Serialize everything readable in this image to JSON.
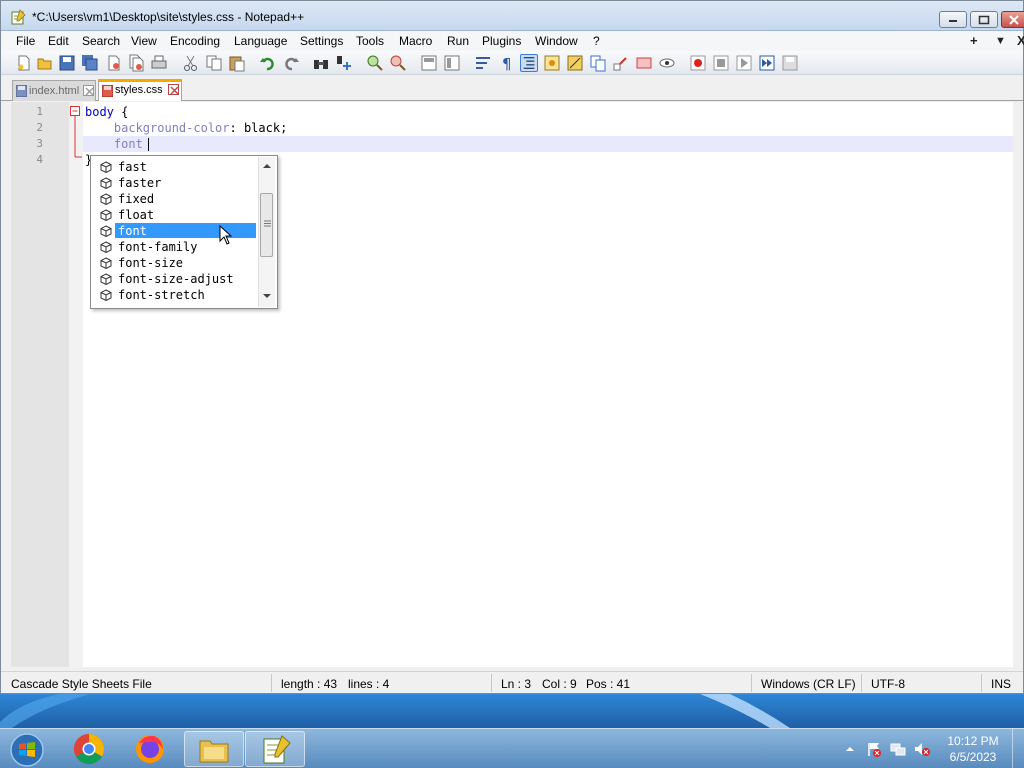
{
  "window": {
    "title": "*C:\\Users\\vm1\\Desktop\\site\\styles.css - Notepad++"
  },
  "menu": {
    "items": [
      "File",
      "Edit",
      "Search",
      "View",
      "Encoding",
      "Language",
      "Settings",
      "Tools",
      "Macro",
      "Run",
      "Plugins",
      "Window",
      "?"
    ],
    "right_plus": "+",
    "right_arrow": "▼",
    "right_close": "X"
  },
  "toolbar": {
    "icons": [
      "new-icon",
      "open-icon",
      "save-icon",
      "save-all-icon",
      "close-icon",
      "close-all-icon",
      "print-icon",
      "cut-icon",
      "copy-icon",
      "paste-icon",
      "undo-icon",
      "redo-icon",
      "find-icon",
      "replace-icon",
      "zoom-in-icon",
      "zoom-out-icon",
      "sync-vertical-icon",
      "sync-horizontal-icon",
      "word-wrap-icon",
      "show-all-chars-icon",
      "indent-guide-icon",
      "udl-icon",
      "doc-map-icon",
      "function-list-icon",
      "folder-workspace-icon",
      "monitoring-icon",
      "record-macro-icon",
      "stop-macro-icon",
      "play-macro-icon",
      "run-multiple-macro-icon",
      "save-macro-icon"
    ]
  },
  "tabs": [
    {
      "label": "index.html",
      "active": false
    },
    {
      "label": "styles.css",
      "active": true
    }
  ],
  "editor": {
    "line_numbers": [
      "1",
      "2",
      "3",
      "4"
    ],
    "line1_selector": "body",
    "line1_brace": " {",
    "line2_property": "background-color",
    "line2_rest": ": black;",
    "line3_typed": "font",
    "line4_brace": "}"
  },
  "autocomplete": {
    "items": [
      "fast",
      "faster",
      "fixed",
      "float",
      "font",
      "font-family",
      "font-size",
      "font-size-adjust",
      "font-stretch"
    ],
    "selected": "font"
  },
  "status": {
    "file_type": "Cascade Style Sheets File",
    "length": "length : 43",
    "lines": "lines : 4",
    "ln": "Ln : 3",
    "col": "Col : 9",
    "pos": "Pos : 41",
    "eol": "Windows (CR LF)",
    "encoding": "UTF-8",
    "mode": "INS"
  },
  "taskbar": {
    "apps": [
      "start-button",
      "chrome-icon",
      "firefox-icon",
      "explorer-icon",
      "notepadpp-icon"
    ],
    "time": "10:12 PM",
    "date": "6/5/2023"
  },
  "colors": {
    "selection": "#3399ff",
    "current_line": "#e8e8ff",
    "tab_accent": "#f6a900"
  }
}
